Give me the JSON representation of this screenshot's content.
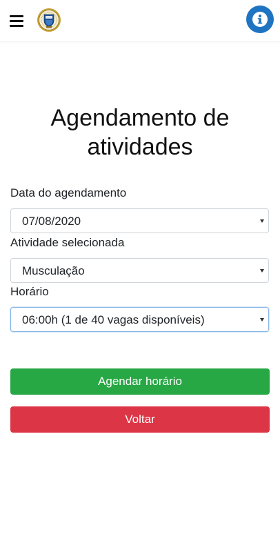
{
  "header": {
    "menu_icon": "hamburger-menu-icon",
    "logo_icon": "emblem-logo",
    "info_icon": "info-icon",
    "accent_color": "#1f74c2"
  },
  "page": {
    "title_line1": "Agendamento de",
    "title_line2": "atividades"
  },
  "form": {
    "date": {
      "label": "Data do agendamento",
      "value": "07/08/2020"
    },
    "activity": {
      "label": "Atividade selecionada",
      "value": "Musculação"
    },
    "time": {
      "label": "Horário",
      "value": "06:00h (1 de 40 vagas disponíveis)"
    }
  },
  "actions": {
    "schedule_label": "Agendar horário",
    "schedule_color": "#28a745",
    "back_label": "Voltar",
    "back_color": "#dc3545"
  }
}
